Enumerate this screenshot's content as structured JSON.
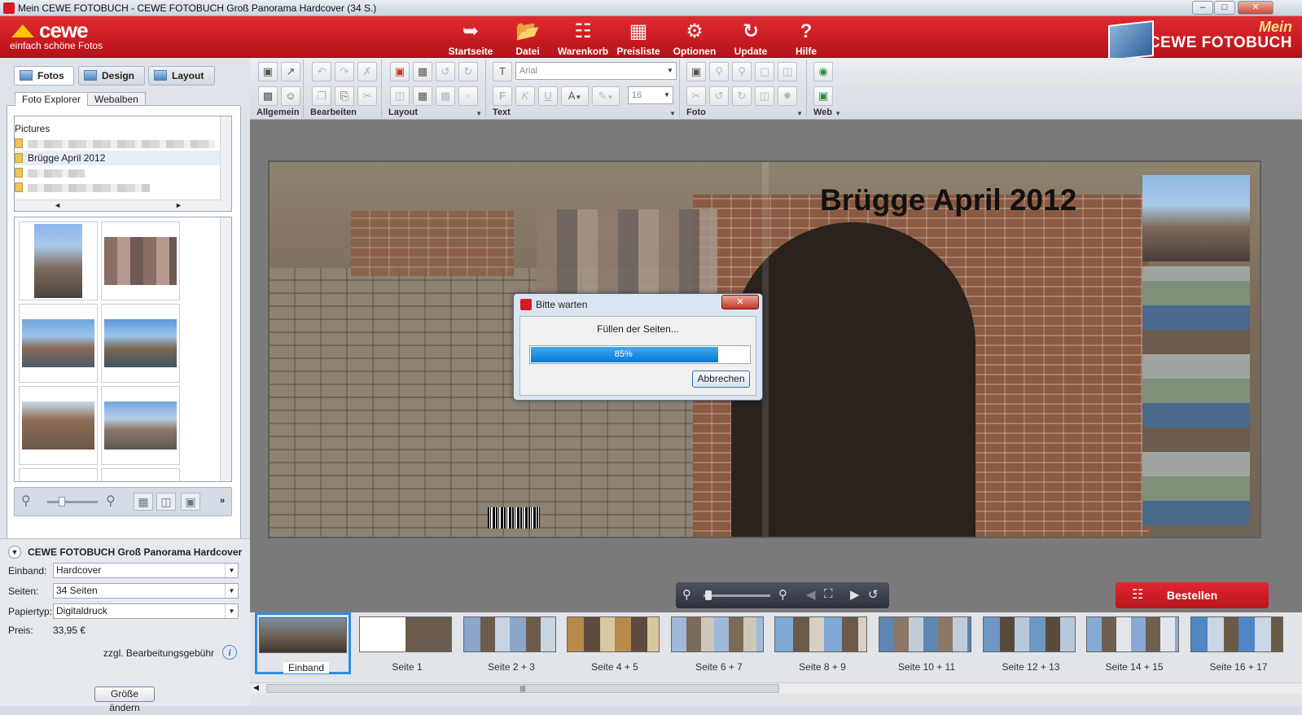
{
  "window": {
    "title": "Mein CEWE FOTOBUCH - CEWE FOTOBUCH Groß Panorama Hardcover (34 S.)"
  },
  "logo": {
    "word": "cewe",
    "tagline": "einfach schöne Fotos"
  },
  "nav": [
    {
      "label": "Startseite",
      "icon": "start-icon"
    },
    {
      "label": "Datei",
      "icon": "file-icon"
    },
    {
      "label": "Warenkorb",
      "icon": "cart-icon"
    },
    {
      "label": "Preisliste",
      "icon": "pricelist-icon"
    },
    {
      "label": "Optionen",
      "icon": "gear-icon"
    },
    {
      "label": "Update",
      "icon": "update-icon"
    },
    {
      "label": "Hilfe",
      "icon": "help-icon"
    }
  ],
  "brand": {
    "line1": "Mein",
    "line2": "CEWE FOTOBUCH"
  },
  "left": {
    "tabs": [
      "Fotos",
      "Design",
      "Layout"
    ],
    "subtabs": [
      "Foto Explorer",
      "Webalben"
    ],
    "tree": {
      "root": "Pictures",
      "items": [
        "Brügge April 2012"
      ]
    }
  },
  "product": {
    "title": "CEWE FOTOBUCH Groß Panorama Hardcover",
    "einband_label": "Einband:",
    "einband": "Hardcover",
    "seiten_label": "Seiten:",
    "seiten": "34 Seiten",
    "papier_label": "Papiertyp:",
    "papier": "Digitaldruck",
    "preis_label": "Preis:",
    "preis": "33,95 €",
    "fee": "zzgl. Bearbeitungsgebühr",
    "resize_button": "Größe ändern"
  },
  "toolbar": {
    "groups": [
      "Allgemein",
      "Bearbeiten",
      "Layout",
      "Text",
      "Foto",
      "Web"
    ],
    "font": "Arial",
    "size": "16",
    "bold": "F",
    "italic": "K",
    "underline": "U",
    "color": "A"
  },
  "canvas": {
    "title": "Brügge April 2012"
  },
  "dialog": {
    "title": "Bitte warten",
    "message": "Füllen der Seiten...",
    "progress_text": "85%",
    "progress": 0.85,
    "cancel": "Abbrechen"
  },
  "bottom": {
    "order": "Bestellen"
  },
  "filmstrip": [
    "Einband",
    "Seite 1",
    "Seite 2 + 3",
    "Seite 4 + 5",
    "Seite 6 + 7",
    "Seite 8 + 9",
    "Seite 10 + 11",
    "Seite 12 + 13",
    "Seite 14 + 15",
    "Seite 16 + 17"
  ],
  "colors": {
    "brand_red": "#d21b24",
    "accent_blue": "#2f8be0",
    "progress_blue": "#0b78d1"
  }
}
